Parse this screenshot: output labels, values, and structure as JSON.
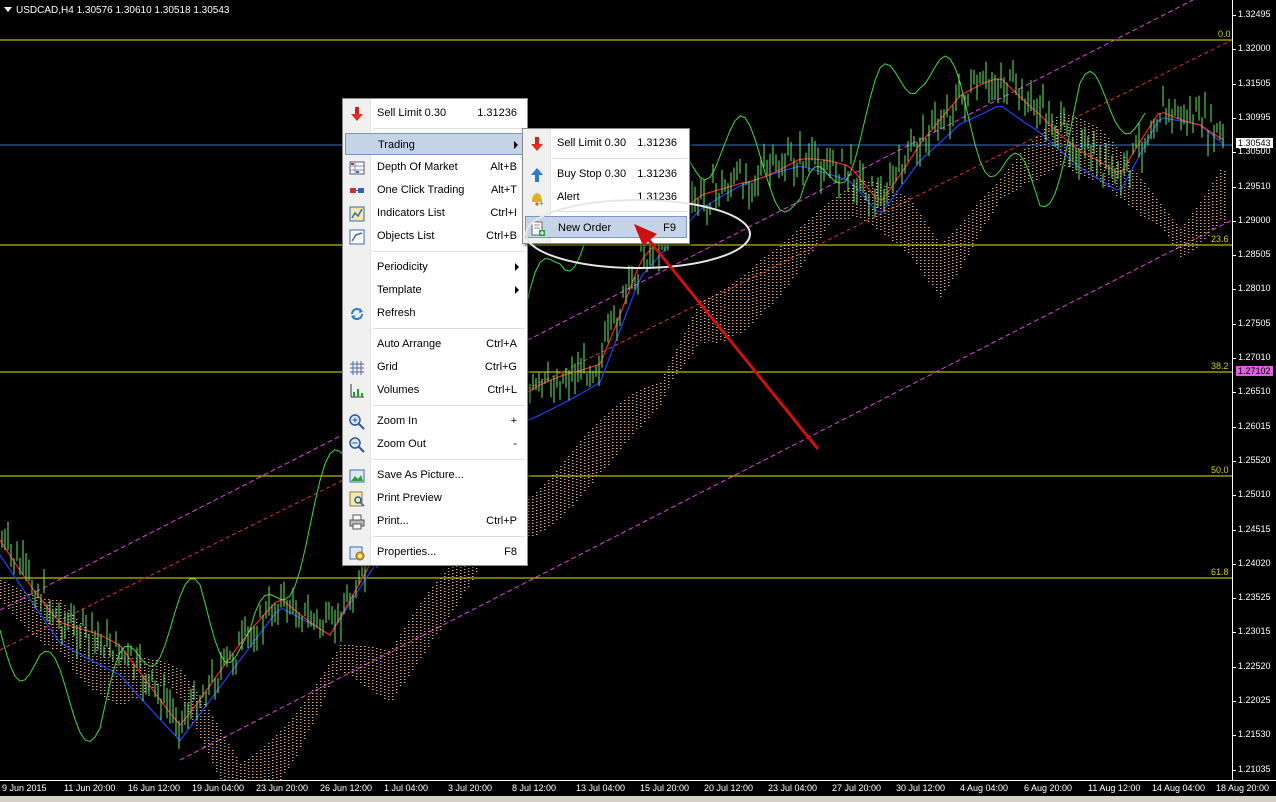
{
  "chart": {
    "symbol_line": "USDCAD,H4  1.30576  1.30610  1.30518  1.30543",
    "price_ticks": [
      "1.32495",
      "1.32000",
      "1.31505",
      "1.30995",
      "1.30500",
      "1.29510",
      "1.29000",
      "1.28505",
      "1.28010",
      "1.27505",
      "1.27010",
      "1.26510",
      "1.26015",
      "1.25520",
      "1.25010",
      "1.24515",
      "1.24020",
      "1.23525",
      "1.23015",
      "1.22520",
      "1.22025",
      "1.21530",
      "1.21035"
    ],
    "current_price_badge": "1.30543",
    "line_price_badge": "1.27102",
    "fib_levels": [
      "0.0",
      "23.6",
      "38.2",
      "50.0",
      "61.8"
    ],
    "time_ticks": [
      "9 Jun 2015",
      "11 Jun 20:00",
      "16 Jun 12:00",
      "19 Jun 04:00",
      "23 Jun 20:00",
      "26 Jun 12:00",
      "1 Jul 04:00",
      "3 Jul 20:00",
      "8 Jul 12:00",
      "13 Jul 04:00",
      "15 Jul 20:00",
      "20 Jul 12:00",
      "23 Jul 04:00",
      "27 Jul 20:00",
      "30 Jul 12:00",
      "4 Aug 04:00",
      "6 Aug 20:00",
      "11 Aug 12:00",
      "14 Aug 04:00",
      "18 Aug 20:00"
    ],
    "colors": {
      "candles": "#5ff05f",
      "chikou": "#3cdc3c",
      "tenkan": "#ff2020",
      "kijun": "#2040ff",
      "kumo": "#ffc89a",
      "fib": "#e6e600",
      "channel": "#e040e0",
      "current_price_line": "#3b6fc8"
    }
  },
  "context_menu": {
    "items": [
      {
        "label": "Sell Limit 0.30",
        "shortcut": "1.31236",
        "icon": "sell-arrow-icon"
      },
      {
        "label": "Trading",
        "shortcut": "",
        "icon": "",
        "submenu": true
      },
      {
        "label": "Depth Of Market",
        "shortcut": "Alt+B",
        "icon": "depth-of-market-icon"
      },
      {
        "label": "One Click Trading",
        "shortcut": "Alt+T",
        "icon": "one-click-trading-icon"
      },
      {
        "label": "Indicators List",
        "shortcut": "Ctrl+I",
        "icon": "indicators-list-icon"
      },
      {
        "label": "Objects List",
        "shortcut": "Ctrl+B",
        "icon": "objects-list-icon"
      },
      {
        "label": "Periodicity",
        "shortcut": "",
        "icon": "",
        "submenu": true
      },
      {
        "label": "Template",
        "shortcut": "",
        "icon": "",
        "submenu": true
      },
      {
        "label": "Refresh",
        "shortcut": "",
        "icon": "refresh-icon"
      },
      {
        "label": "Auto Arrange",
        "shortcut": "Ctrl+A",
        "icon": ""
      },
      {
        "label": "Grid",
        "shortcut": "Ctrl+G",
        "icon": "grid-icon"
      },
      {
        "label": "Volumes",
        "shortcut": "Ctrl+L",
        "icon": "volumes-icon"
      },
      {
        "label": "Zoom In",
        "shortcut": "+",
        "icon": "zoom-in-icon"
      },
      {
        "label": "Zoom Out",
        "shortcut": "-",
        "icon": "zoom-out-icon"
      },
      {
        "label": "Save As Picture...",
        "shortcut": "",
        "icon": "save-picture-icon"
      },
      {
        "label": "Print Preview",
        "shortcut": "",
        "icon": "print-preview-icon"
      },
      {
        "label": "Print...",
        "shortcut": "Ctrl+P",
        "icon": "printer-icon"
      },
      {
        "label": "Properties...",
        "shortcut": "F8",
        "icon": "properties-icon"
      }
    ]
  },
  "trading_submenu": {
    "items": [
      {
        "label": "Sell Limit 0.30",
        "shortcut": "1.31236",
        "icon": "sell-arrow-icon"
      },
      {
        "label": "Buy Stop 0.30",
        "shortcut": "1.31236",
        "icon": "buy-arrow-icon"
      },
      {
        "label": "Alert",
        "shortcut": "1.31236",
        "icon": "alert-bell-icon"
      },
      {
        "label": "New Order",
        "shortcut": "F9",
        "icon": "new-order-icon"
      }
    ]
  }
}
